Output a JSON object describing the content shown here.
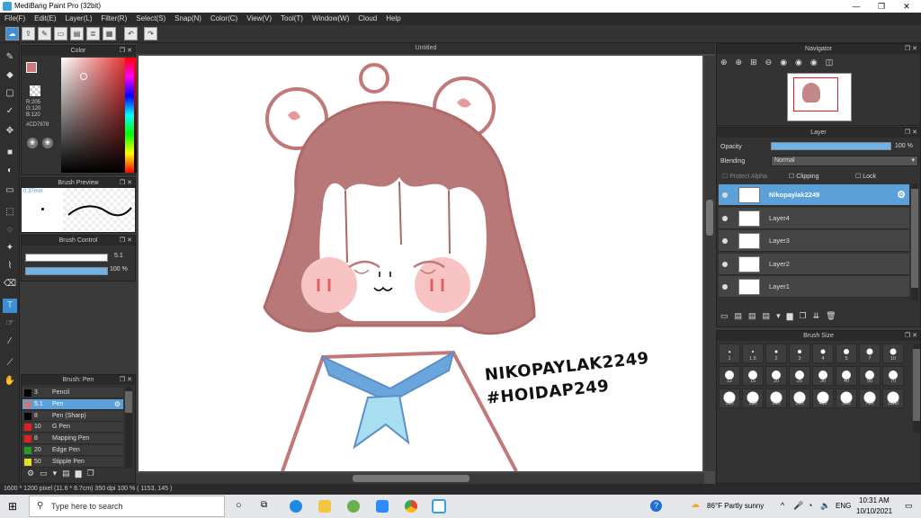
{
  "window": {
    "title": "MediBang Paint Pro (32bit)",
    "minimize": "—",
    "maximize": "❐",
    "close": "✕"
  },
  "menu": [
    "File(F)",
    "Edit(E)",
    "Layer(L)",
    "Filter(R)",
    "Select(S)",
    "Snap(N)",
    "Color(C)",
    "View(V)",
    "Tool(T)",
    "Window(W)",
    "Cloud",
    "Help"
  ],
  "panels": {
    "color": {
      "title": "Color",
      "r": "R:205",
      "g": "G:120",
      "b": "B:120",
      "hex": "#CD7878",
      "fg_color": "#CD7878",
      "bg_color": "#FFFFFF"
    },
    "brush_preview": {
      "title": "Brush Preview",
      "size": "0.37mm"
    },
    "brush_control": {
      "title": "Brush Control",
      "size_value": "5.1",
      "opacity_value": "100 %",
      "opacity_fraction": 1.0,
      "size_fraction": 0.92
    },
    "brush_list": {
      "title": "Brush: Pen",
      "items": [
        {
          "num": "3",
          "name": "Pencil",
          "color": "#000000",
          "selected": false
        },
        {
          "num": "5.1",
          "name": "Pen",
          "color": "#CD7878",
          "selected": true
        },
        {
          "num": "8",
          "name": "Pen (Sharp)",
          "color": "#000000",
          "selected": false
        },
        {
          "num": "10",
          "name": "G Pen",
          "color": "#e02020",
          "selected": false
        },
        {
          "num": "8",
          "name": "Mapping Pen",
          "color": "#e02020",
          "selected": false
        },
        {
          "num": "20",
          "name": "Edge Pen",
          "color": "#20a020",
          "selected": false
        },
        {
          "num": "50",
          "name": "Stipple Pen",
          "color": "#e0e020",
          "selected": false
        }
      ]
    },
    "navigator": {
      "title": "Navigator"
    },
    "layer": {
      "title": "Layer",
      "opacity_label": "Opacity",
      "opacity_value": "100 %",
      "opacity_fraction": 1.0,
      "blending_label": "Blending",
      "blending_value": "Normal",
      "protect_alpha": "Protect Alpha",
      "clipping": "Clipping",
      "lock": "Lock",
      "layers": [
        {
          "name": "Nikopaylak2249",
          "selected": true
        },
        {
          "name": "Layer4",
          "selected": false
        },
        {
          "name": "Layer3",
          "selected": false
        },
        {
          "name": "Layer2",
          "selected": false
        },
        {
          "name": "Layer1",
          "selected": false
        }
      ]
    },
    "brush_size": {
      "title": "Brush Size",
      "sizes": [
        "1",
        "1.5",
        "2",
        "3",
        "4",
        "5",
        "7",
        "10",
        "12",
        "15",
        "20",
        "25",
        "30",
        "40",
        "50",
        "70",
        "100",
        "150",
        "200",
        "300",
        "400",
        "500",
        "700",
        "1000"
      ]
    }
  },
  "canvas": {
    "tab_title": "Untitled",
    "text_line1": "NIKOPAYLAK2249",
    "text_line2": "#HOIDAP249"
  },
  "status": {
    "text": "1600 * 1200 pixel   (11.6 * 8.7cm)  350 dpi  100 %  ( 1153, 145 )"
  },
  "taskbar": {
    "search_placeholder": "Type here to search",
    "weather": "86°F  Partly sunny",
    "lang": "ENG",
    "time": "10:31 AM",
    "date": "10/10/2021"
  }
}
